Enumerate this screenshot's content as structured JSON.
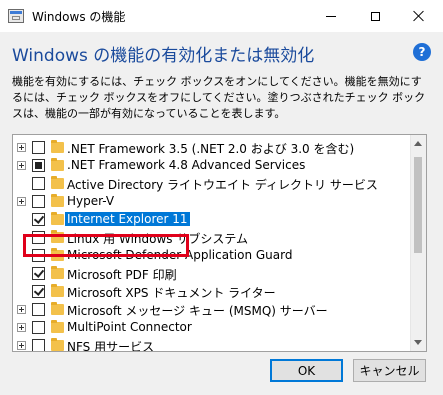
{
  "window": {
    "title": "Windows の機能"
  },
  "header": {
    "heading": "Windows の機能の有効化または無効化",
    "help_symbol": "?",
    "description": "機能を有効にするには、チェック ボックスをオンにしてください。機能を無効にするには、チェック ボックスをオフにしてください。塗りつぶされたチェック ボックスは、機能の一部が有効になっていることを表します。"
  },
  "features": [
    {
      "label": ".NET Framework 3.5 (.NET 2.0 および 3.0 を含む)",
      "expandable": true,
      "state": "unchecked"
    },
    {
      "label": ".NET Framework 4.8 Advanced Services",
      "expandable": true,
      "state": "partial"
    },
    {
      "label": "Active Directory ライトウエイト ディレクトリ サービス",
      "expandable": false,
      "state": "unchecked"
    },
    {
      "label": "Hyper-V",
      "expandable": true,
      "state": "unchecked"
    },
    {
      "label": "Internet Explorer 11",
      "expandable": false,
      "state": "checked",
      "selected": true
    },
    {
      "label": "Linux 用 Windows サブシステム",
      "expandable": false,
      "state": "unchecked"
    },
    {
      "label": "Microsoft Defender Application Guard",
      "expandable": false,
      "state": "unchecked"
    },
    {
      "label": "Microsoft PDF 印刷",
      "expandable": false,
      "state": "checked"
    },
    {
      "label": "Microsoft XPS ドキュメント ライター",
      "expandable": false,
      "state": "checked"
    },
    {
      "label": "Microsoft メッセージ キュー (MSMQ) サーバー",
      "expandable": true,
      "state": "unchecked"
    },
    {
      "label": "MultiPoint Connector",
      "expandable": true,
      "state": "unchecked"
    },
    {
      "label": "NFS 用サービス",
      "expandable": true,
      "state": "unchecked"
    }
  ],
  "buttons": {
    "ok": "OK",
    "cancel": "キャンセル"
  },
  "colors": {
    "heading": "#1a4a9c",
    "selection": "#0078d7",
    "highlight_box": "#e0001a",
    "folder": "#f3c14b"
  },
  "icons": {
    "app": "window-features-icon",
    "help": "help-icon",
    "folder": "folder-icon"
  }
}
